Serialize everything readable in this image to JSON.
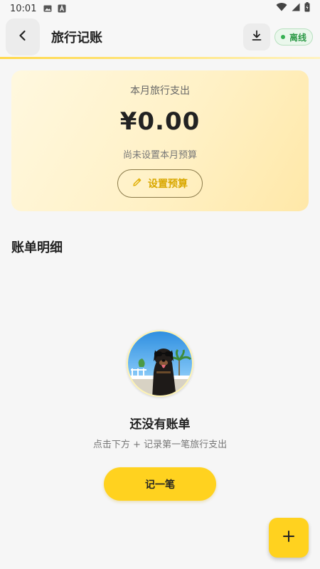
{
  "status_bar": {
    "time": "10:01",
    "icons": [
      "image-icon",
      "a-icon",
      "wifi-icon",
      "signal-icon",
      "battery-icon"
    ]
  },
  "header": {
    "title": "旅行记账",
    "back_icon": "chevron-left-icon",
    "download_icon": "download-icon",
    "offline_label": "离线"
  },
  "budget_card": {
    "label": "本月旅行支出",
    "amount": "¥0.00",
    "status": "尚未设置本月预算",
    "set_budget_label": "设置预算",
    "set_budget_icon": "pencil-icon"
  },
  "section": {
    "title": "账单明细"
  },
  "empty_state": {
    "title": "还没有账单",
    "subtitle": "点击下方 + 记录第一笔旅行支出",
    "button_label": "记一笔"
  },
  "fab": {
    "icon": "plus-icon"
  },
  "colors": {
    "accent": "#ffd21f",
    "accent_text": "#d9a800",
    "offline_green": "#2e9a48",
    "background": "#f6f6f6"
  }
}
